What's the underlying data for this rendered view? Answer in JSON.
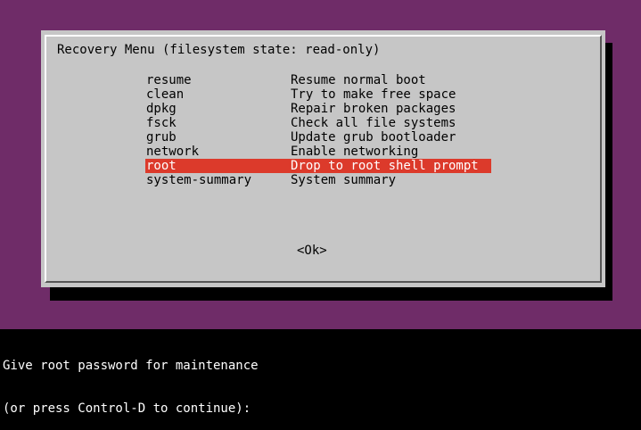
{
  "dialog": {
    "title": "Recovery Menu (filesystem state: read-only)",
    "ok_label": "<Ok>"
  },
  "menu": {
    "selected_index": 6,
    "items": [
      {
        "key": "resume",
        "description": "Resume normal boot"
      },
      {
        "key": "clean",
        "description": "Try to make free space"
      },
      {
        "key": "dpkg",
        "description": "Repair broken packages"
      },
      {
        "key": "fsck",
        "description": "Check all file systems"
      },
      {
        "key": "grub",
        "description": "Update grub bootloader"
      },
      {
        "key": "network",
        "description": "Enable networking"
      },
      {
        "key": "root",
        "description": "Drop to root shell prompt"
      },
      {
        "key": "system-summary",
        "description": "System summary"
      }
    ]
  },
  "console": {
    "lines": [
      "Give root password for maintenance",
      "(or press Control-D to continue):"
    ]
  },
  "colors": {
    "background": "#6f2c68",
    "dialog": "#c6c6c6",
    "highlight": "#dc3a2b",
    "console": "#000000"
  }
}
